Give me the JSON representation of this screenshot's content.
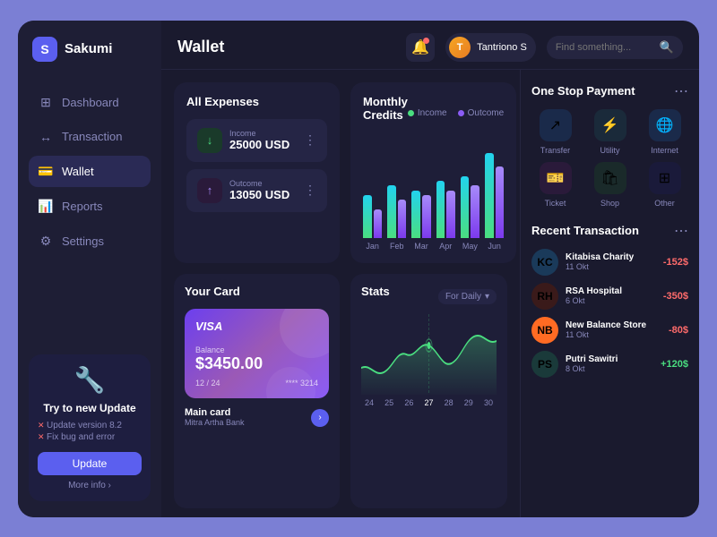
{
  "app": {
    "name": "Sakumi",
    "page_title": "Wallet"
  },
  "header": {
    "notification_badge": "●",
    "user_name": "Tantriono S",
    "search_placeholder": "Find something..."
  },
  "nav": {
    "items": [
      {
        "label": "Dashboard",
        "icon": "⊞",
        "active": false
      },
      {
        "label": "Transaction",
        "icon": "↔",
        "active": false
      },
      {
        "label": "Wallet",
        "icon": "💳",
        "active": true
      },
      {
        "label": "Reports",
        "icon": "📊",
        "active": false
      },
      {
        "label": "Settings",
        "icon": "⚙",
        "active": false
      }
    ]
  },
  "sidebar_update": {
    "title": "Try to new Update",
    "items": [
      "Update version 8.2",
      "Fix bug and error"
    ],
    "button_label": "Update",
    "more_label": "More info"
  },
  "expenses": {
    "title": "All Expenses",
    "income": {
      "label": "Income",
      "amount": "25000 USD"
    },
    "outcome": {
      "label": "Outcome",
      "amount": "13050 USD"
    }
  },
  "monthly_credits": {
    "title": "Monthly Credits",
    "legend": [
      {
        "label": "Income",
        "color": "#4ade80"
      },
      {
        "label": "Outcome",
        "color": "#8b5cf6"
      }
    ],
    "months": [
      "Jan",
      "Feb",
      "Mar",
      "Apr",
      "May",
      "Jun"
    ],
    "income_bars": [
      45,
      55,
      50,
      60,
      65,
      90
    ],
    "outcome_bars": [
      30,
      40,
      45,
      50,
      55,
      75
    ]
  },
  "your_card": {
    "title": "Your Card",
    "visa_label": "VISA",
    "balance_label": "Balance",
    "balance": "$3450.00",
    "expiry": "12 / 24",
    "number": "**** 3214",
    "card_name": "Main card",
    "bank_name": "Mitra Artha Bank"
  },
  "stats": {
    "title": "Stats",
    "filter_label": "For Daily",
    "labels": [
      "24",
      "25",
      "26",
      "27",
      "28",
      "29",
      "30"
    ],
    "active_label": "27"
  },
  "one_stop_payment": {
    "title": "One Stop Payment",
    "items": [
      {
        "label": "Transfer",
        "icon": "↗",
        "bg": "#1a2a4a",
        "color": "#4ade80"
      },
      {
        "label": "Utility",
        "icon": "⚡",
        "bg": "#1a2a3a",
        "color": "#22d3ee"
      },
      {
        "label": "Internet",
        "icon": "🌐",
        "bg": "#1a2a4a",
        "color": "#a78bfa"
      },
      {
        "label": "Ticket",
        "icon": "🎫",
        "bg": "#2a1a3a",
        "color": "#f472b6"
      },
      {
        "label": "Shop",
        "icon": "🛍",
        "bg": "#1a2a2a",
        "color": "#4ade80"
      },
      {
        "label": "Other",
        "icon": "⊞",
        "bg": "#1a1a3a",
        "color": "#a78bfa"
      }
    ]
  },
  "recent_transactions": {
    "title": "Recent Transaction",
    "items": [
      {
        "name": "Kitabisa Charity",
        "date": "11 Okt",
        "amount": "-152$",
        "sign": "negative",
        "initials": "KC",
        "bg": "#1a3a5a"
      },
      {
        "name": "RSA Hospital",
        "date": "6 Okt",
        "amount": "-350$",
        "sign": "negative",
        "initials": "RH",
        "bg": "#3a1a1a"
      },
      {
        "name": "New Balance Store",
        "date": "11 Okt",
        "amount": "-80$",
        "sign": "negative",
        "initials": "NB",
        "bg": "#ff6b23"
      },
      {
        "name": "Putri Sawitri",
        "date": "8 Okt",
        "amount": "+120$",
        "sign": "positive",
        "initials": "PS",
        "bg": "#1a3a3a"
      }
    ]
  }
}
